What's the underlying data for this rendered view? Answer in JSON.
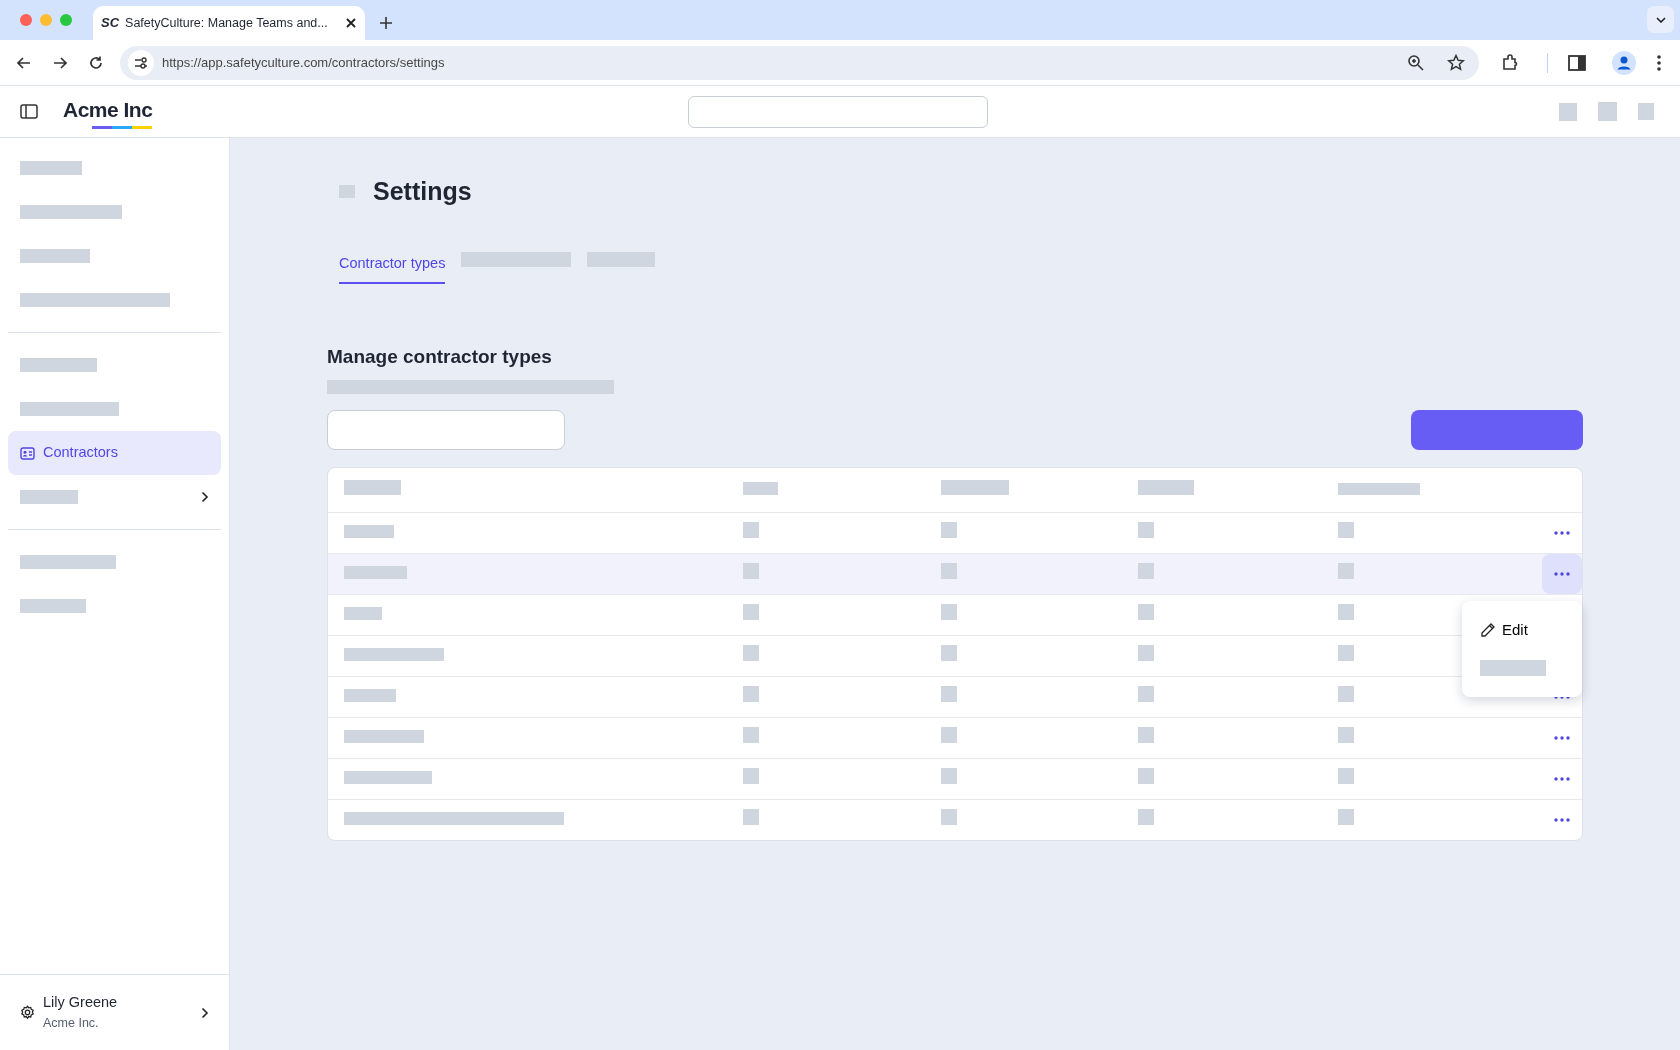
{
  "browser": {
    "tab_favicon": "SC",
    "tab_title": "SafetyCulture: Manage Teams and...",
    "url": "https://app.safetyculture.com/contractors/settings"
  },
  "app_header": {
    "logo": "Acme Inc"
  },
  "sidebar": {
    "items": [
      {
        "kind": "placeholder"
      },
      {
        "kind": "placeholder"
      },
      {
        "kind": "placeholder"
      },
      {
        "kind": "placeholder"
      },
      {
        "kind": "divider"
      },
      {
        "kind": "placeholder"
      },
      {
        "kind": "placeholder"
      },
      {
        "kind": "link",
        "label": "Contractors",
        "selected": true
      },
      {
        "kind": "group"
      },
      {
        "kind": "divider"
      },
      {
        "kind": "placeholder"
      },
      {
        "kind": "placeholder"
      }
    ],
    "user": {
      "name": "Lily Greene",
      "org": "Acme Inc."
    }
  },
  "page": {
    "title": "Settings",
    "tabs": [
      {
        "kind": "label",
        "label": "Contractor types",
        "selected": true
      },
      {
        "kind": "placeholder",
        "selected": false
      },
      {
        "kind": "placeholder",
        "selected": false
      }
    ],
    "section_title": "Manage contractor types"
  },
  "table": {
    "rows": [
      {
        "selected": false
      },
      {
        "selected": true
      },
      {
        "selected": false
      },
      {
        "selected": false
      },
      {
        "selected": false
      },
      {
        "selected": false
      },
      {
        "selected": false
      },
      {
        "selected": false
      }
    ]
  },
  "row_menu": {
    "items": [
      {
        "kind": "action",
        "label": "Edit"
      },
      {
        "kind": "placeholder"
      }
    ]
  }
}
